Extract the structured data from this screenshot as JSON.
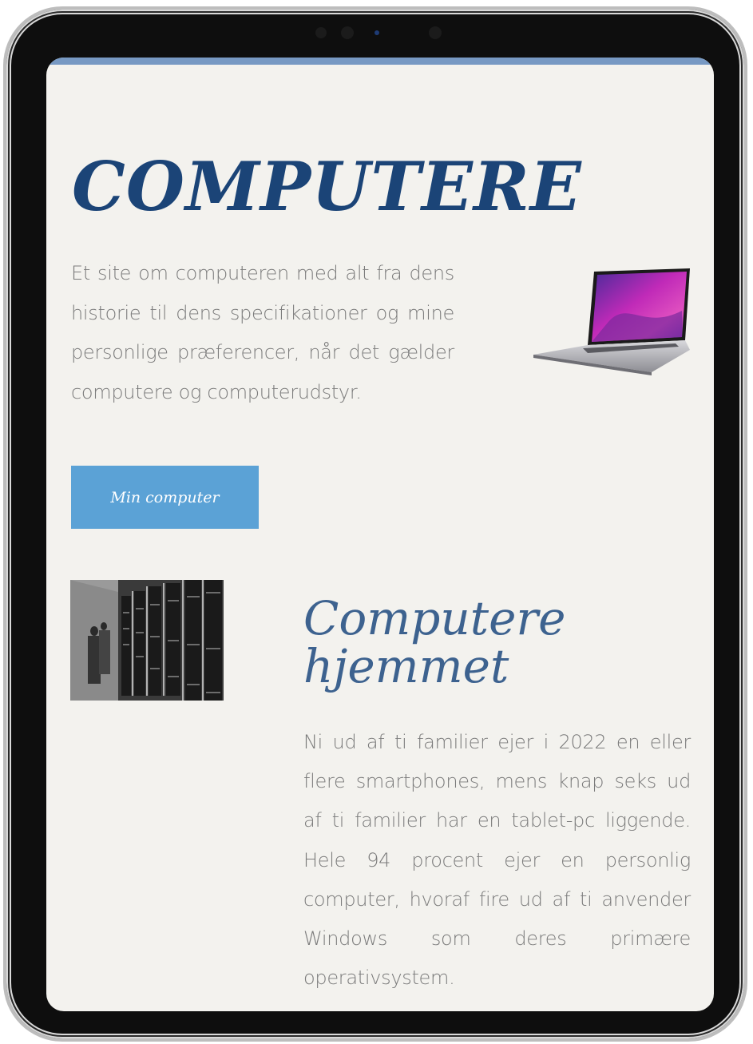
{
  "hero": {
    "title": "COMPUTERE",
    "intro": "Et site om computeren med alt fra dens historie til dens specifikationer og mine personlige præferencer, når det gælder computere og computerudstyr.",
    "cta_label": "Min computer"
  },
  "section": {
    "title_line1": "Computere",
    "title_line2": "hjemmet",
    "body": "Ni ud af ti familier ejer i 2022 en eller flere smartphones, mens knap seks ud af ti familier har en tablet-pc liggende. Hele 94 procent ejer en personlig computer, hvoraf fire ud af ti anvender Windows som deres primære operativsystem."
  },
  "images": {
    "laptop": "laptop-photo",
    "mainframe": "mainframe-photo"
  },
  "colors": {
    "title": "#1b4477",
    "section_title": "#3d628f",
    "body_text": "#7b7b7b",
    "button": "#5ba2d6",
    "background": "#f3f2ee",
    "top_strip": "#7799c3"
  }
}
